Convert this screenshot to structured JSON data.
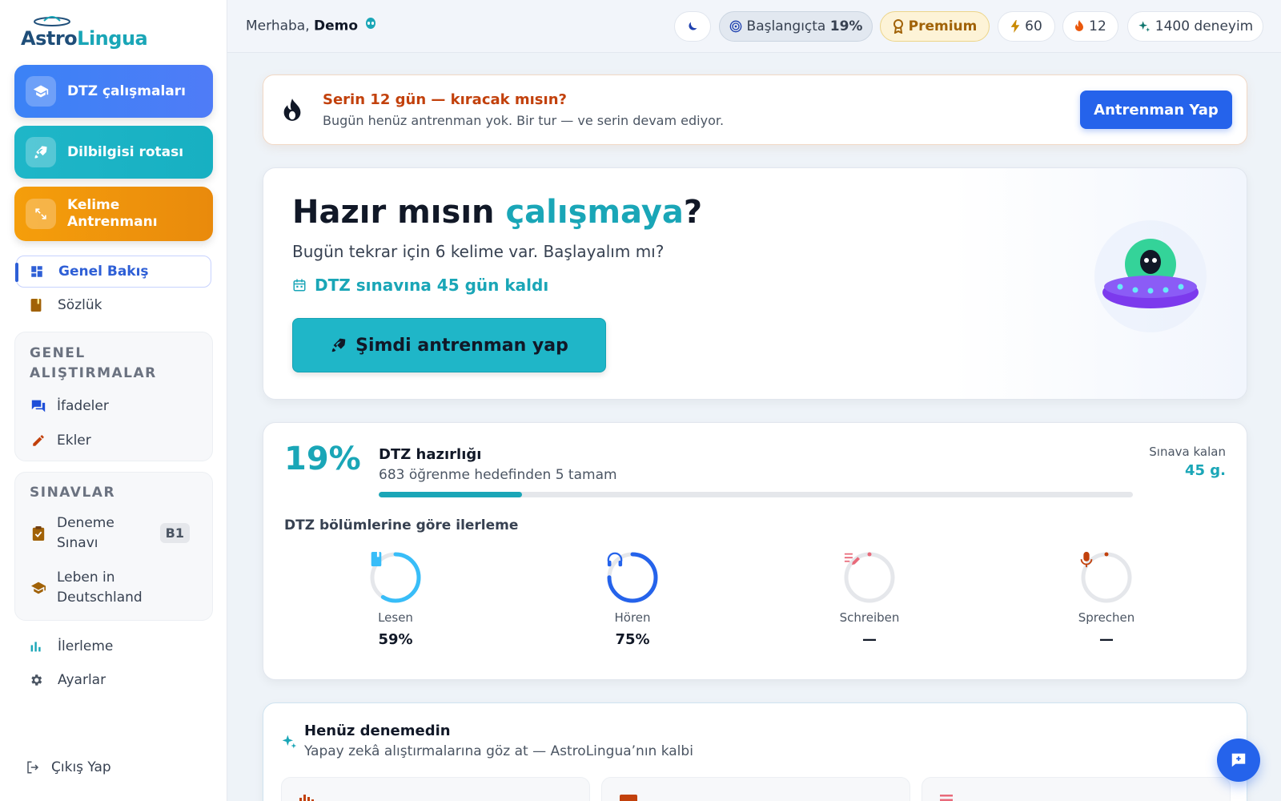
{
  "app": {
    "name_part1": "Astro",
    "name_part2": "Lingua"
  },
  "sidebar": {
    "primary": [
      {
        "label": "DTZ çalışmaları",
        "icon": "graduation-cap-icon"
      },
      {
        "label": "Dilbilgisi rotası",
        "icon": "rocket-icon"
      },
      {
        "label": "Kelime Antrenmanı",
        "icon": "arrows-expand-icon"
      }
    ],
    "nav": [
      {
        "label": "Genel Bakış",
        "icon": "dashboard-icon",
        "active": true
      },
      {
        "label": "Sözlük",
        "icon": "book-icon"
      }
    ],
    "group_general": {
      "title": "GENEL ALIŞTIRMALAR",
      "items": [
        {
          "label": "İfadeler",
          "icon": "chat-icon"
        },
        {
          "label": "Ekler",
          "icon": "pencil-icon"
        }
      ]
    },
    "group_exams": {
      "title": "SINAVLAR",
      "items": [
        {
          "label": "Deneme Sınavı",
          "icon": "clipboard-check-icon",
          "badge": "B1"
        },
        {
          "label": "Leben in Deutschland",
          "icon": "graduation-cap-icon"
        }
      ]
    },
    "bottom": [
      {
        "label": "İlerleme",
        "icon": "bar-chart-icon"
      },
      {
        "label": "Ayarlar",
        "icon": "gear-icon"
      }
    ],
    "logout": "Çıkış Yap"
  },
  "topbar": {
    "greeting": "Merhaba,",
    "user": "Demo",
    "level_label": "Başlangıçta",
    "level_value": "19%",
    "premium": "Premium",
    "energy": "60",
    "streak": "12",
    "xp": "1400 deneyim"
  },
  "banner": {
    "title": "Serin 12 gün — kıracak mısın?",
    "subtitle": "Bugün henüz antrenman yok. Bir tur — ve serin devam ediyor.",
    "button": "Antrenman Yap"
  },
  "hero": {
    "title_start": "Hazır mısın ",
    "title_highlight": "çalışmaya",
    "title_end": "?",
    "subtitle": "Bugün tekrar için 6 kelime var. Başlayalım mı?",
    "countdown": "DTZ sınavına 45 gün kaldı",
    "cta": "Şimdi antrenman yap"
  },
  "progress": {
    "percent": "19%",
    "fraction": 0.19,
    "title": "DTZ hazırlığı",
    "subtitle": "683 öğrenme hedefinden 5 tamam",
    "remaining_label": "Sınava kalan",
    "remaining_value": "45 g.",
    "section_title": "DTZ bölümlerine göre ilerleme",
    "sections": [
      {
        "name": "Lesen",
        "value": "59%",
        "fraction": 0.59,
        "color": "#38bdf8",
        "icon": "book-icon"
      },
      {
        "name": "Hören",
        "value": "75%",
        "fraction": 0.75,
        "color": "#2563eb",
        "icon": "headphones-icon"
      },
      {
        "name": "Schreiben",
        "value": "—",
        "fraction": 0,
        "color": "#e86a7a",
        "icon": "edit-icon"
      },
      {
        "name": "Sprechen",
        "value": "—",
        "fraction": 0,
        "color": "#c2410c",
        "icon": "microphone-icon"
      }
    ]
  },
  "tried": {
    "title": "Henüz denemedin",
    "subtitle": "Yapay zekâ alıştırmalarına göz at — AstroLingua’nın kalbi"
  },
  "colors": {
    "accent": "#1aa6b7",
    "primary": "#2563eb",
    "streak": "#c2410c"
  }
}
